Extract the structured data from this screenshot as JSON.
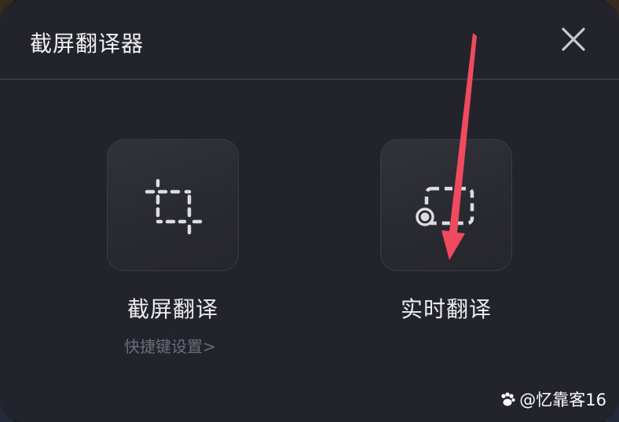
{
  "dialog": {
    "title": "截屏翻译器",
    "close_icon": "close-icon"
  },
  "options": [
    {
      "label": "截屏翻译",
      "icon": "crop-icon",
      "sub_link": "快捷键设置>"
    },
    {
      "label": "实时翻译",
      "icon": "realtime-capture-icon"
    }
  ],
  "annotation": {
    "arrow_color": "#f04a5e"
  },
  "watermark": {
    "text": "@忆靠客16",
    "icon": "paw-icon"
  },
  "colors": {
    "dialog_bg": "#23232b",
    "tile_bg": "#2c2c34",
    "text_primary": "#ededf0",
    "text_muted": "#6c6c76"
  }
}
